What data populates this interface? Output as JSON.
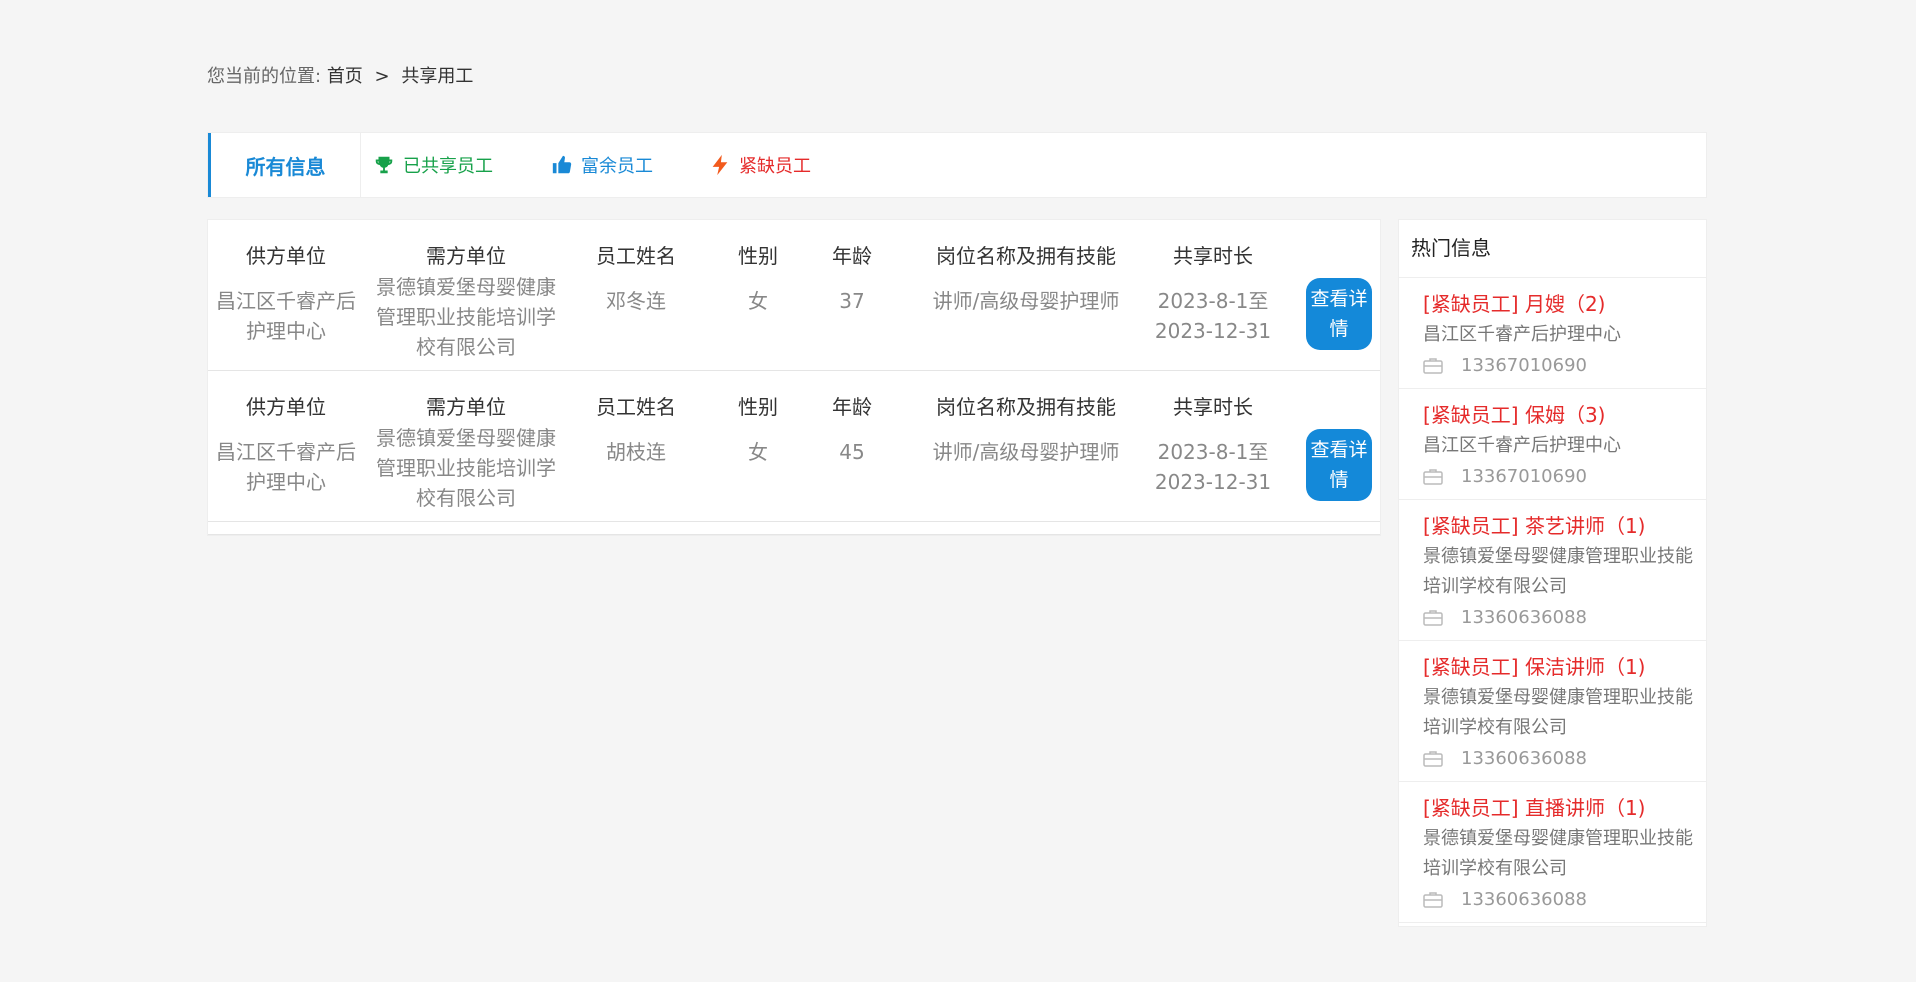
{
  "breadcrumb": {
    "prefix": "您当前的位置:",
    "home": "首页",
    "separator": ">",
    "current": "共享用工"
  },
  "tabs": {
    "all": "所有信息",
    "shared": "已共享员工",
    "surplus": "富余员工",
    "shortage": "紧缺员工"
  },
  "columns": [
    "供方单位",
    "需方单位",
    "员工姓名",
    "性别",
    "年龄",
    "岗位名称及拥有技能",
    "共享时长"
  ],
  "records": [
    {
      "supplier": "昌江区千睿产后护理中心",
      "demander": "景德镇爱堡母婴健康管理职业技能培训学校有限公司",
      "name": "邓冬连",
      "gender": "女",
      "age": "37",
      "position": "讲师/高级母婴护理师",
      "duration": "2023-8-1至2023-12-31",
      "button": "查看详情"
    },
    {
      "supplier": "昌江区千睿产后护理中心",
      "demander": "景德镇爱堡母婴健康管理职业技能培训学校有限公司",
      "name": "胡枝连",
      "gender": "女",
      "age": "45",
      "position": "讲师/高级母婴护理师",
      "duration": "2023-8-1至2023-12-31",
      "button": "查看详情"
    }
  ],
  "sidebar": {
    "title": "热门信息",
    "items": [
      {
        "title": "[紧缺员工] 月嫂（2)",
        "org": "昌江区千睿产后护理中心",
        "phone": "13367010690"
      },
      {
        "title": "[紧缺员工] 保姆（3)",
        "org": "昌江区千睿产后护理中心",
        "phone": "13367010690"
      },
      {
        "title": "[紧缺员工] 茶艺讲师（1)",
        "org": "景德镇爱堡母婴健康管理职业技能培训学校有限公司",
        "phone": "13360636088"
      },
      {
        "title": "[紧缺员工] 保洁讲师（1)",
        "org": "景德镇爱堡母婴健康管理职业技能培训学校有限公司",
        "phone": "13360636088"
      },
      {
        "title": "[紧缺员工] 直播讲师（1)",
        "org": "景德镇爱堡母婴健康管理职业技能培训学校有限公司",
        "phone": "13360636088"
      }
    ]
  },
  "colors": {
    "accent": "#1989d6",
    "green": "#17a14a",
    "red": "#e52b2b",
    "button": "#1489d9"
  }
}
